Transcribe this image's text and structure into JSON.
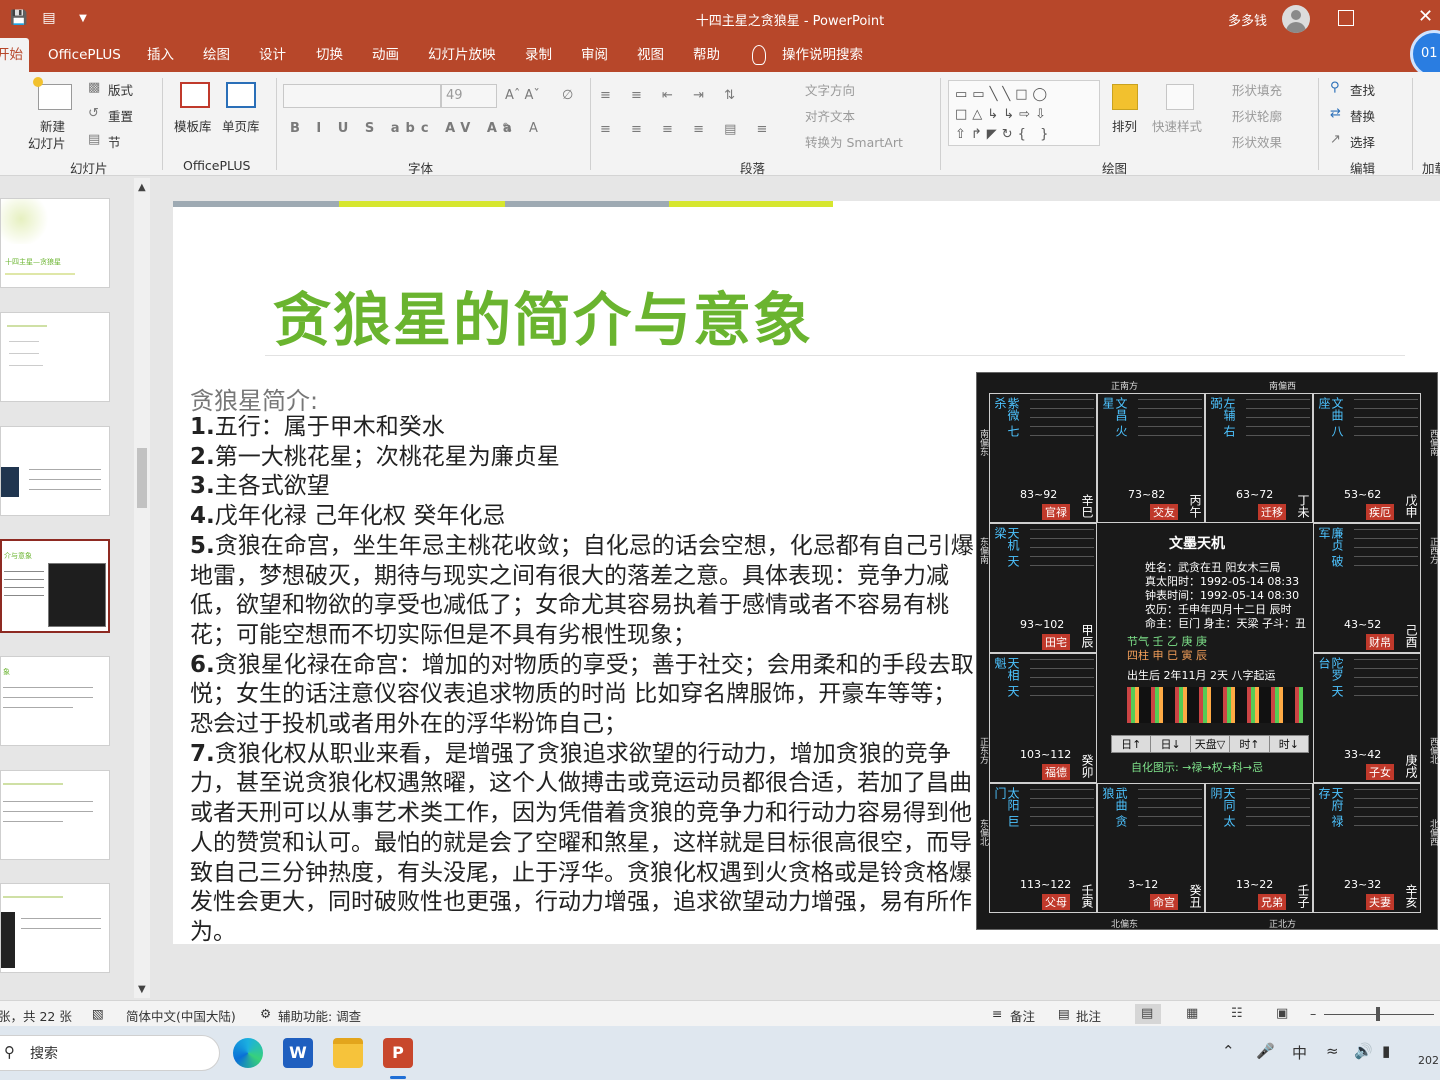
{
  "window": {
    "title": "十四主星之贪狼星  -  PowerPoint",
    "user": "多多钱"
  },
  "tabs": [
    {
      "label": "开始",
      "active": true
    },
    {
      "label": "OfficePLUS"
    },
    {
      "label": "插入"
    },
    {
      "label": "绘图"
    },
    {
      "label": "设计"
    },
    {
      "label": "切换"
    },
    {
      "label": "动画"
    },
    {
      "label": "幻灯片放映"
    },
    {
      "label": "录制"
    },
    {
      "label": "审阅"
    },
    {
      "label": "视图"
    },
    {
      "label": "帮助"
    },
    {
      "label": "操作说明搜索"
    }
  ],
  "clock_badge": "01",
  "ribbon": {
    "slides": {
      "new_slide": "新建",
      "new_slide2": "幻灯片",
      "layout": "版式",
      "reset": "重置",
      "section": "节",
      "group": "幻灯片"
    },
    "officeplus": {
      "template": "模板库",
      "single": "单页库",
      "group": "OfficePLUS"
    },
    "font": {
      "size": "49",
      "group": "字体"
    },
    "paragraph": {
      "text_dir": "文字方向",
      "align_text": "对齐文本",
      "smartart": "转换为 SmartArt",
      "group": "段落"
    },
    "drawing": {
      "arrange": "排列",
      "quick_styles": "快速样式",
      "shape_fill": "形状填充",
      "shape_outline": "形状轮廓",
      "shape_effects": "形状效果",
      "group": "绘图"
    },
    "editing": {
      "find": "查找",
      "replace": "替换",
      "select": "选择",
      "group": "编辑",
      "more": "加载"
    }
  },
  "slide": {
    "title": "贪狼星的简介与意象",
    "subtitle": "贪狼星简介:",
    "paragraphs": [
      {
        "num": "1.",
        "text": "五行：属于甲木和癸水"
      },
      {
        "num": "2.",
        "text": "第一大桃花星；次桃花星为廉贞星"
      },
      {
        "num": "3.",
        "text": "主各式欲望"
      },
      {
        "num": "4.",
        "text": "戊年化禄 己年化权  癸年化忌"
      },
      {
        "num": "5.",
        "text": "贪狼在命宫，坐生年忌主桃花收敛；自化忌的话会空想，化忌都有自己引爆地雷，梦想破灭，期待与现实之间有很大的落差之意。具体表现：竞争力减低，欲望和物欲的享受也减低了；女命尤其容易执着于感情或者不容易有桃花；可能空想而不切实际但是不具有劣根性现象；"
      },
      {
        "num": "6.",
        "text": "贪狼星化禄在命宫：增加的对物质的享受；善于社交；会用柔和的手段去取悦；女生的话注意仪容仪表追求物质的时尚 比如穿名牌服饰，开豪车等等；恐会过于投机或者用外在的浮华粉饰自己；"
      },
      {
        "num": "7.",
        "text": "贪狼化权从职业来看，是增强了贪狼追求欲望的行动力，增加贪狼的竞争力，甚至说贪狼化权遇煞曜，这个人做搏击或竞运动员都很合适，若加了昌曲或者天刑可以从事艺术类工作，因为凭借着贪狼的竞争力和行动力容易得到他人的赞赏和认可。最怕的就是会了空曜和煞星，这样就是目标很高很空，而导致自己三分钟热度，有头没尾，止于浮华。贪狼化权遇到火贪格或是铃贪格爆发性会更大，同时破败性也更强，行动力增强，追求欲望动力增强，易有所作为。"
      }
    ]
  },
  "thumbs": [
    {
      "title": "十四主星—贪狼星"
    },
    {
      "title": ""
    },
    {
      "title": ""
    },
    {
      "title": "介与意象"
    },
    {
      "title": "象"
    },
    {
      "title": ""
    },
    {
      "title": ""
    }
  ],
  "chart": {
    "directions": {
      "top1": "正南方",
      "top2": "南偏西",
      "bottom1": "北偏东",
      "bottom2": "正北方",
      "left1": "南偏东",
      "left2": "东偏南",
      "left3": "正东方",
      "left4": "东偏北",
      "right1": "西偏南",
      "right2": "正西方",
      "right3": "西偏北",
      "right4": "北偏西"
    },
    "palaces": [
      {
        "stars": "紫微 七杀",
        "age": "83~92",
        "palace": "官禄",
        "gz": "辛巳",
        "badge_color": "#c0392b"
      },
      {
        "stars": "文昌 火星",
        "age": "73~82",
        "palace": "交友",
        "gz": "丙午",
        "badge_color": "#c0392b"
      },
      {
        "stars": "左辅 右弼",
        "age": "63~72",
        "palace": "迁移",
        "gz": "丁未",
        "badge_color": "#c0392b"
      },
      {
        "stars": "文曲 八座",
        "age": "53~62",
        "palace": "疾厄",
        "gz": "戊申",
        "badge_color": "#c0392b"
      },
      {
        "stars": "天机 天梁",
        "age": "93~102",
        "palace": "田宅",
        "gz": "甲辰",
        "badge_color": "#c0392b"
      },
      {
        "stars": "廉贞 破军",
        "age": "43~52",
        "palace": "财帛",
        "gz": "己酉",
        "badge_color": "#c0392b"
      },
      {
        "stars": "天相 天魁",
        "age": "103~112",
        "palace": "福德",
        "gz": "癸卯",
        "badge_color": "#c0392b"
      },
      {
        "stars": "陀罗 天台",
        "age": "33~42",
        "palace": "子女",
        "gz": "庚戌",
        "badge_color": "#c0392b"
      },
      {
        "stars": "太阳 巨门",
        "age": "113~122",
        "palace": "父母",
        "gz": "壬寅",
        "badge_color": "#c0392b"
      },
      {
        "stars": "武曲 贪狼",
        "age": "3~12",
        "palace": "命宫",
        "gz": "癸丑",
        "badge_color": "#c0392b"
      },
      {
        "stars": "天同 太阴",
        "age": "13~22",
        "palace": "兄弟",
        "gz": "壬子",
        "badge_color": "#c0392b"
      },
      {
        "stars": "天府 禄存",
        "age": "23~32",
        "palace": "夫妻",
        "gz": "辛亥",
        "badge_color": "#c0392b"
      }
    ],
    "center": {
      "title": "文墨天机",
      "lines": [
        "姓名：武贪在丑   阳女木三局",
        "真太阳时：1992-05-14 08:33",
        "钟表时间：1992-05-14 08:30",
        "农历：壬申年四月十二日 辰时",
        "命主：巨门 身主：天梁 子斗：丑",
        "节气  壬   乙   庚   庚",
        "四柱  申   巳   寅   辰",
        "出生后 2年11月 2天 八字起运"
      ],
      "controls": [
        "日↑",
        "日↓",
        "天盘▽",
        "时↑",
        "时↓"
      ],
      "legend": "自化图示: →禄→权→科→忌"
    }
  },
  "status": {
    "slide_info": "张，共 22 张",
    "language": "简体中文(中国大陆)",
    "accessibility": "辅助功能: 调查",
    "notes": "备注",
    "comments": "批注"
  },
  "taskbar": {
    "search": "搜索",
    "ime": "中",
    "year": "202"
  }
}
